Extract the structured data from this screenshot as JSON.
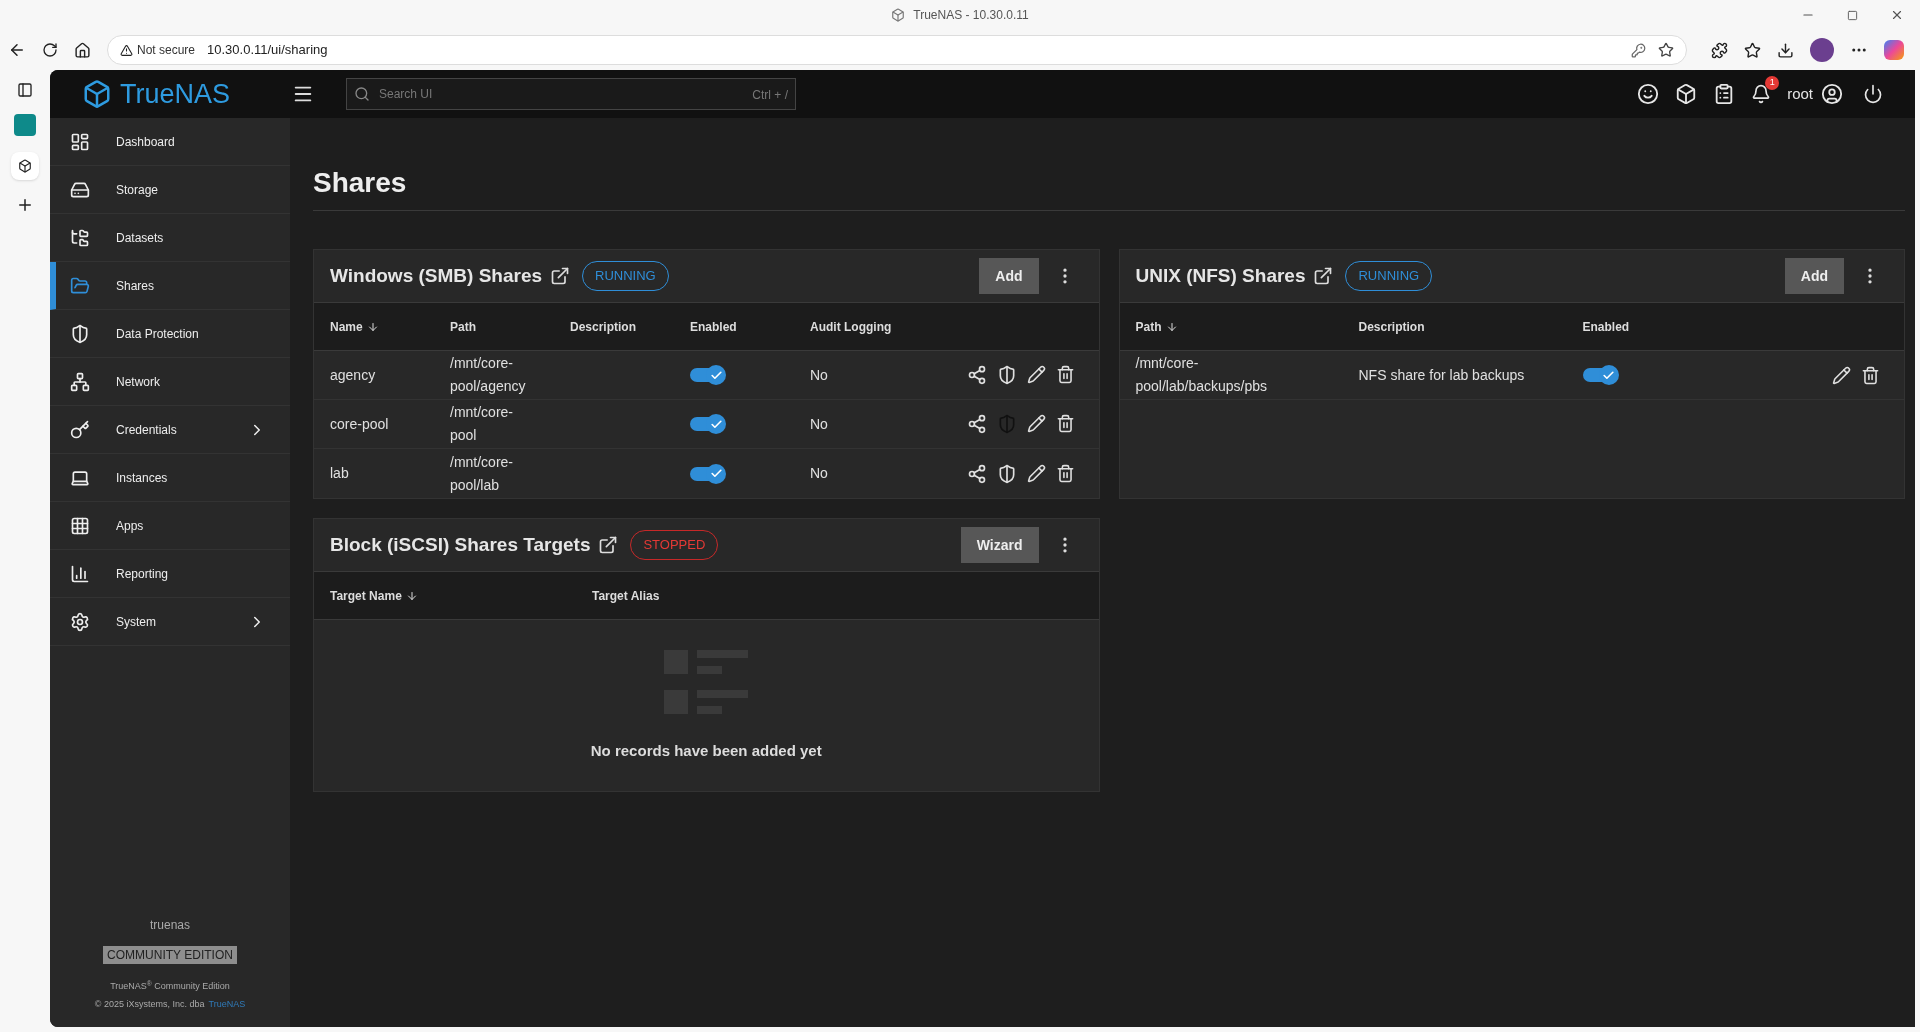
{
  "browser": {
    "title": "TrueNAS - 10.30.0.11",
    "security": "Not secure",
    "url": "10.30.0.11/ui/sharing"
  },
  "header": {
    "logo": "TrueNAS",
    "search_placeholder": "Search UI",
    "shortcut": "Ctrl + /",
    "notification_count": "1",
    "user": "root"
  },
  "sidebar": {
    "items": [
      {
        "kind": "dashboard",
        "label": "Dashboard",
        "selected": false,
        "expandable": false
      },
      {
        "kind": "storage",
        "label": "Storage",
        "selected": false,
        "expandable": false
      },
      {
        "kind": "datasets",
        "label": "Datasets",
        "selected": false,
        "expandable": false
      },
      {
        "kind": "shares",
        "label": "Shares",
        "selected": true,
        "expandable": false
      },
      {
        "kind": "protection",
        "label": "Data Protection",
        "selected": false,
        "expandable": false
      },
      {
        "kind": "network",
        "label": "Network",
        "selected": false,
        "expandable": false
      },
      {
        "kind": "credentials",
        "label": "Credentials",
        "selected": false,
        "expandable": true
      },
      {
        "kind": "instances",
        "label": "Instances",
        "selected": false,
        "expandable": false
      },
      {
        "kind": "apps",
        "label": "Apps",
        "selected": false,
        "expandable": false
      },
      {
        "kind": "reporting",
        "label": "Reporting",
        "selected": false,
        "expandable": false
      },
      {
        "kind": "system",
        "label": "System",
        "selected": false,
        "expandable": true
      }
    ],
    "hostname": "truenas",
    "edition": "COMMUNITY EDITION",
    "product_line": "TrueNAS$^{®}$ Community Edition",
    "copyright": "© 2025 iXsystems, Inc. dba",
    "copyright_link": "TrueNAS"
  },
  "page_title": "Shares",
  "smb": {
    "title": "Windows (SMB) Shares",
    "status": {
      "label": "RUNNING",
      "running": true
    },
    "action": "Add",
    "columns": [
      {
        "label": "Name",
        "sorted": true
      },
      {
        "label": "Path",
        "sorted": false
      },
      {
        "label": "Description",
        "sorted": false
      },
      {
        "label": "Enabled",
        "sorted": false
      },
      {
        "label": "Audit Logging",
        "sorted": false
      }
    ],
    "rows": [
      {
        "name": "agency",
        "path": "/mnt/core-pool/agency",
        "enabled": true,
        "audit_logging": "No",
        "acl_available": true
      },
      {
        "name": "core-pool",
        "path": "/mnt/core-pool",
        "enabled": true,
        "audit_logging": "No",
        "acl_available": false
      },
      {
        "name": "lab",
        "path": "/mnt/core-pool/lab",
        "enabled": true,
        "audit_logging": "No",
        "acl_available": true
      }
    ]
  },
  "iscsi": {
    "title": "Block (iSCSI) Shares Targets",
    "status": {
      "label": "STOPPED",
      "running": false
    },
    "action": "Wizard",
    "columns": [
      {
        "label": "Target Name",
        "sorted": true
      },
      {
        "label": "Target Alias",
        "sorted": false
      }
    ],
    "empty_message": "No records have been added yet"
  },
  "nfs": {
    "title": "UNIX (NFS) Shares",
    "status": {
      "label": "RUNNING",
      "running": true
    },
    "action": "Add",
    "columns": [
      {
        "label": "Path",
        "sorted": true
      },
      {
        "label": "Description",
        "sorted": false
      },
      {
        "label": "Enabled",
        "sorted": false
      }
    ],
    "rows": [
      {
        "path": "/mnt/core-pool/lab/backups/pbs",
        "description": "NFS share for lab backups",
        "enabled": true
      }
    ]
  }
}
